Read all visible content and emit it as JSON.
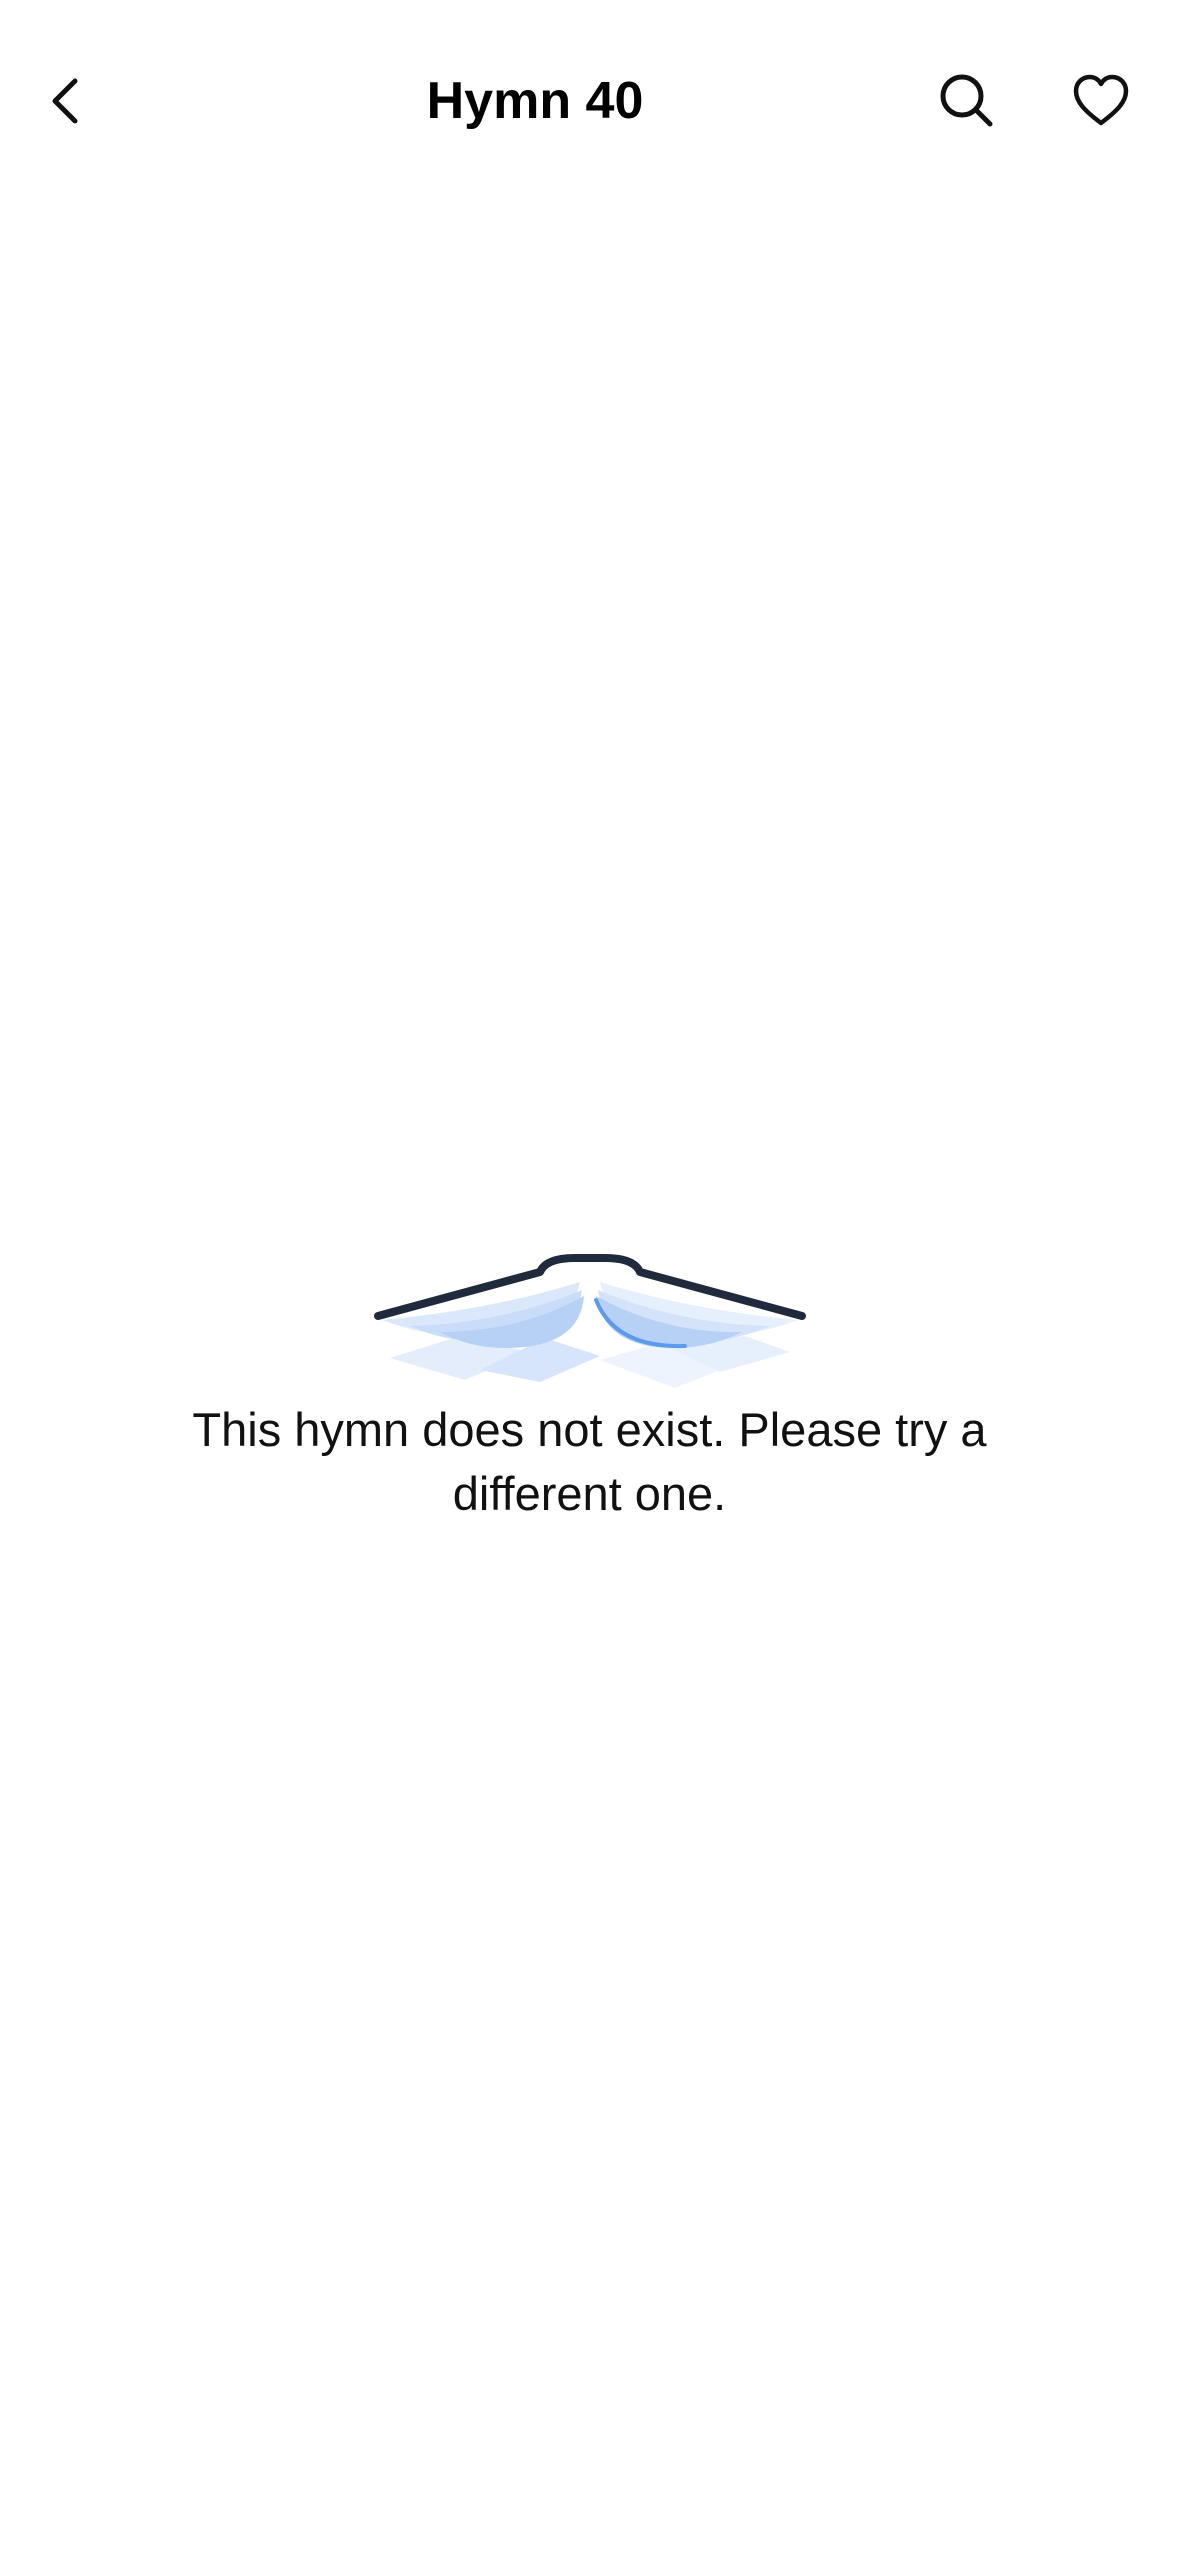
{
  "header": {
    "title": "Hymn 40",
    "icons": {
      "back": "chevron-left-icon",
      "search": "search-icon",
      "favorite": "heart-icon"
    }
  },
  "empty_state": {
    "illustration": "open-book-icon",
    "message": "This hymn does not exist. Please try a different one."
  },
  "colors": {
    "background": "#ffffff",
    "text": "#111111",
    "book_cover": "#1f2a3d",
    "book_page_light": "#dbe8fb",
    "book_page_mid": "#b7d0f5",
    "book_page_accent": "#5b9bec"
  }
}
